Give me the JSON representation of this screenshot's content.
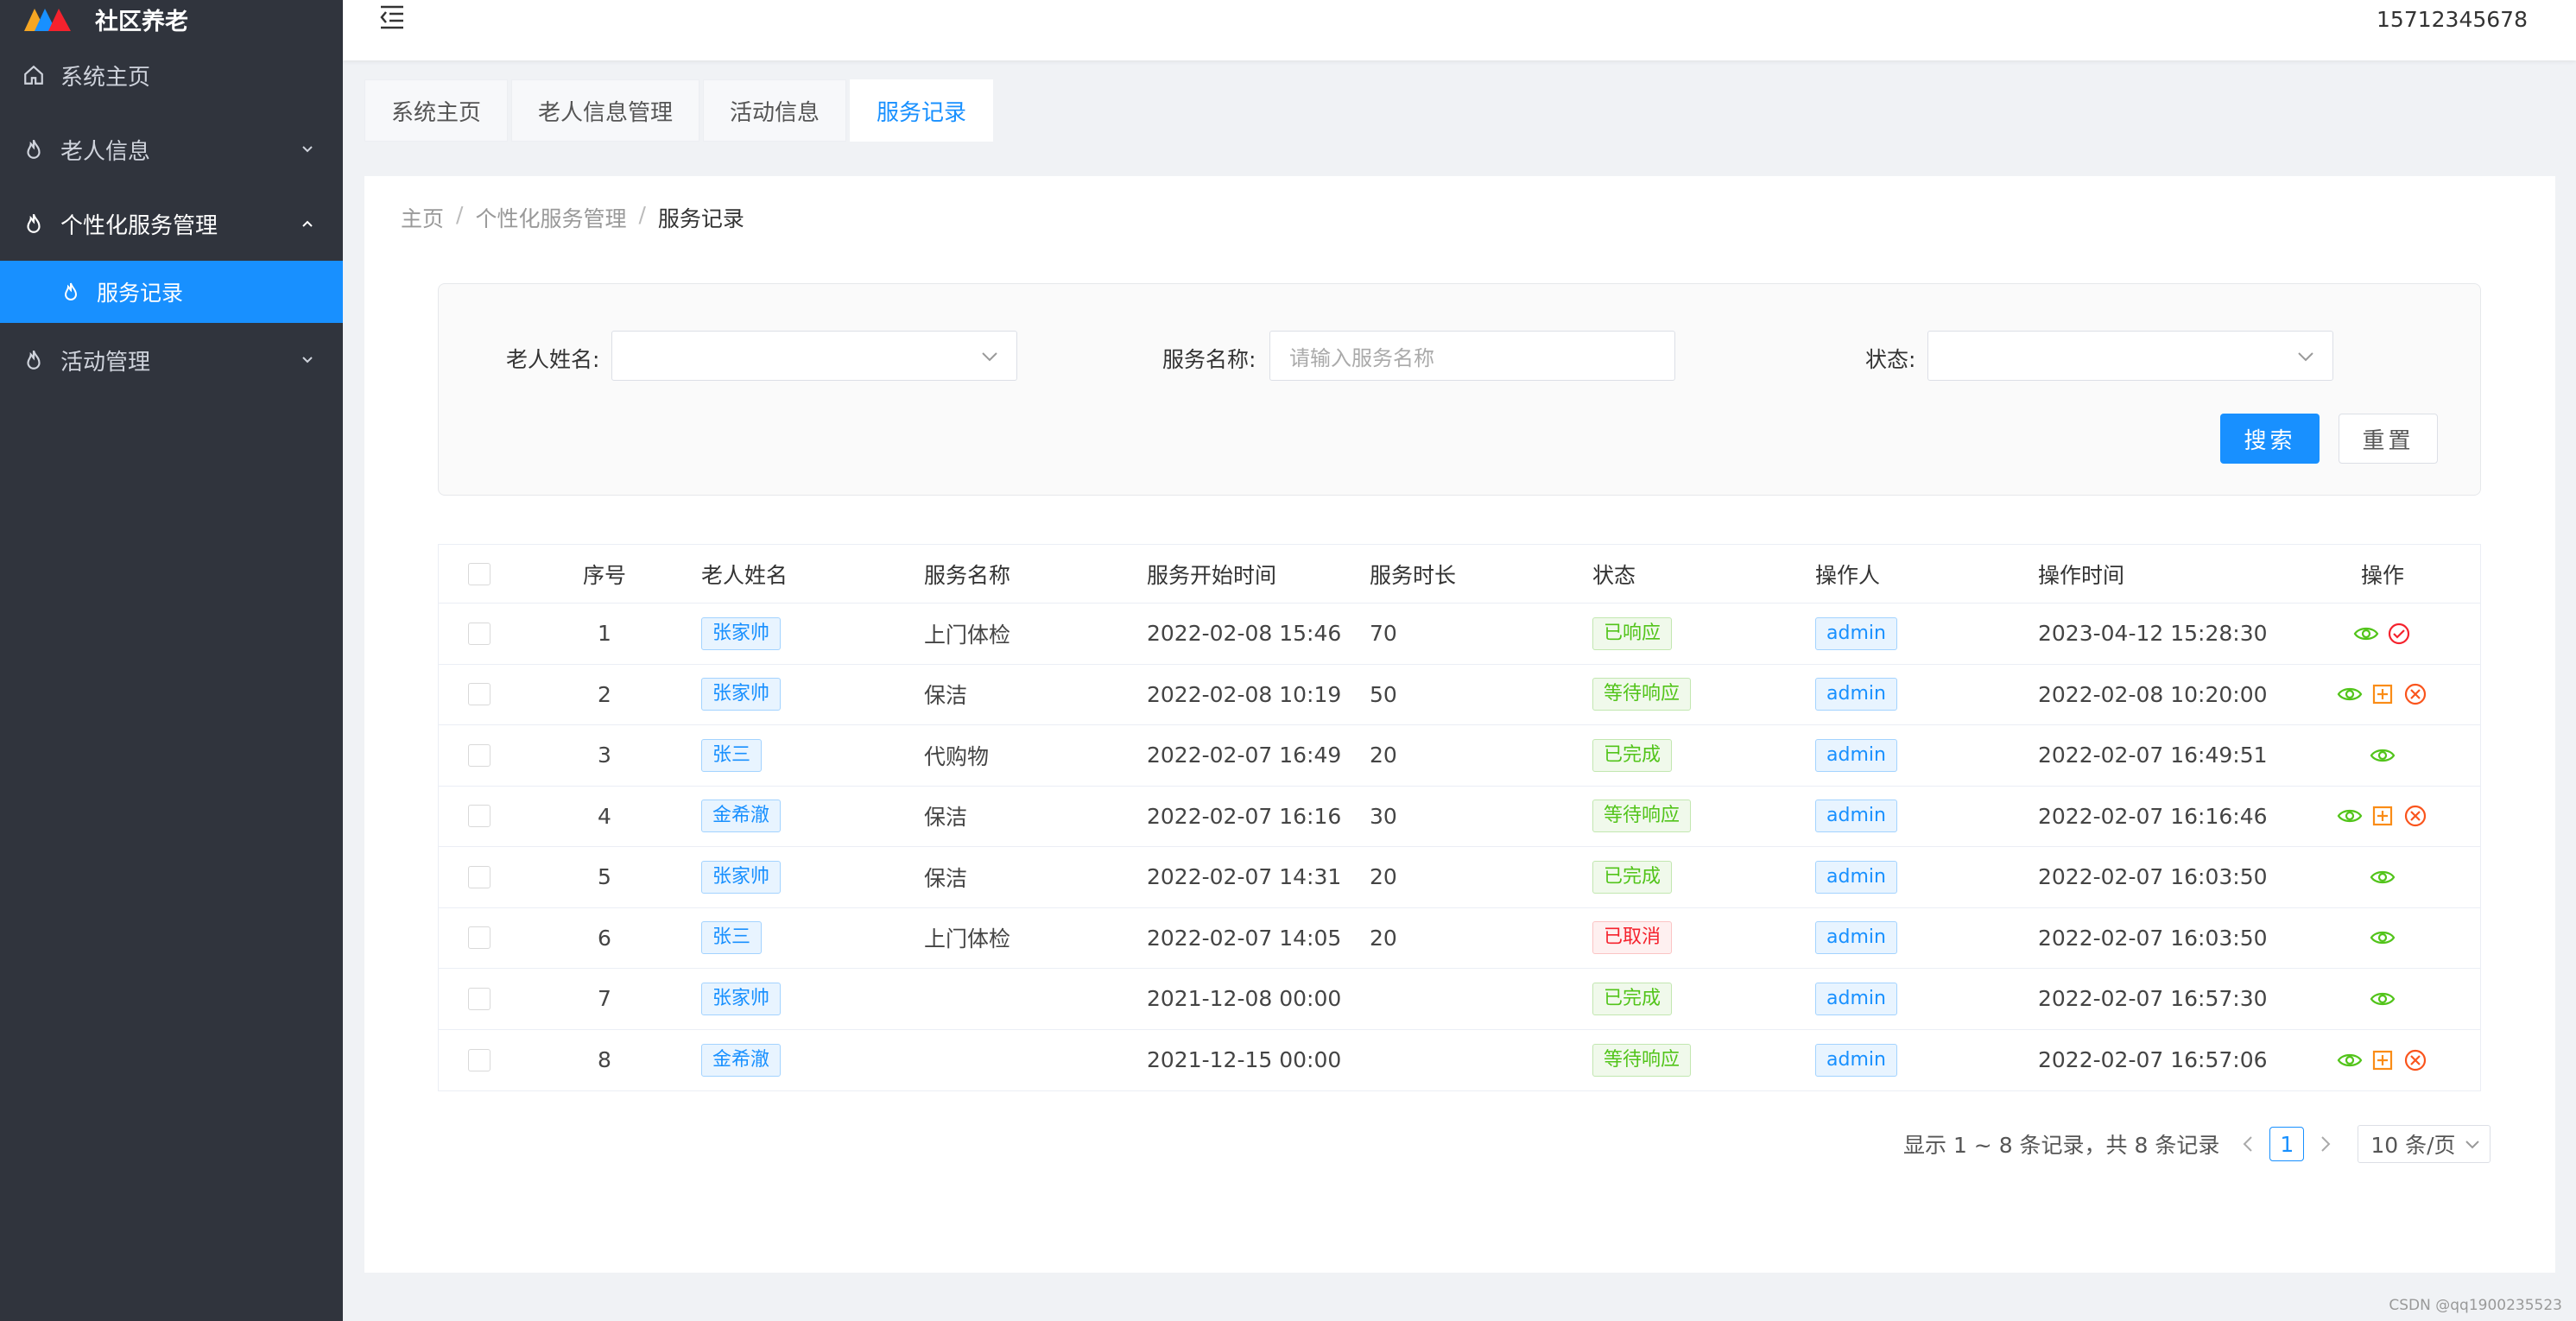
{
  "app": {
    "title": "社区养老",
    "user_phone": "15712345678"
  },
  "colors": {
    "sidebar_bg": "#30343d",
    "accent": "#1890ff",
    "success": "#52c41a",
    "danger": "#f5222d",
    "warning": "#fa8c16"
  },
  "sidebar": {
    "items": [
      {
        "label": "系统主页",
        "icon": "home-icon"
      },
      {
        "label": "老人信息",
        "icon": "flame-icon"
      },
      {
        "label": "个性化服务管理",
        "icon": "flame-icon"
      },
      {
        "label": "活动管理",
        "icon": "flame-icon"
      }
    ],
    "submenu": {
      "label": "服务记录",
      "icon": "flame-icon"
    }
  },
  "tabs": [
    {
      "label": "系统主页"
    },
    {
      "label": "老人信息管理"
    },
    {
      "label": "活动信息"
    },
    {
      "label": "服务记录"
    }
  ],
  "breadcrumb": {
    "home": "主页",
    "sep": "/",
    "level1": "个性化服务管理",
    "current": "服务记录"
  },
  "search": {
    "elder_label": "老人姓名:",
    "service_label": "服务名称:",
    "service_placeholder": "请输入服务名称",
    "status_label": "状态:",
    "search_button": "搜索",
    "reset_button": "重置"
  },
  "table": {
    "headers": [
      "序号",
      "老人姓名",
      "服务名称",
      "服务开始时间",
      "服务时长",
      "状态",
      "操作人",
      "操作时间",
      "操作"
    ],
    "rows": [
      {
        "idx": "1",
        "name": "张家帅",
        "service": "上门体检",
        "start": "2022-02-08 15:46",
        "duration": "70",
        "status": "已响应",
        "operator": "admin",
        "time": "2023-04-12 15:28:30"
      },
      {
        "idx": "2",
        "name": "张家帅",
        "service": "保洁",
        "start": "2022-02-08 10:19",
        "duration": "50",
        "status": "等待响应",
        "operator": "admin",
        "time": "2022-02-08 10:20:00"
      },
      {
        "idx": "3",
        "name": "张三",
        "service": "代购物",
        "start": "2022-02-07 16:49",
        "duration": "20",
        "status": "已完成",
        "operator": "admin",
        "time": "2022-02-07 16:49:51"
      },
      {
        "idx": "4",
        "name": "金希澈",
        "service": "保洁",
        "start": "2022-02-07 16:16",
        "duration": "30",
        "status": "等待响应",
        "operator": "admin",
        "time": "2022-02-07 16:16:46"
      },
      {
        "idx": "5",
        "name": "张家帅",
        "service": "保洁",
        "start": "2022-02-07 14:31",
        "duration": "20",
        "status": "已完成",
        "operator": "admin",
        "time": "2022-02-07 16:03:50"
      },
      {
        "idx": "6",
        "name": "张三",
        "service": "上门体检",
        "start": "2022-02-07 14:05",
        "duration": "20",
        "status": "已取消",
        "operator": "admin",
        "time": "2022-02-07 16:03:50"
      },
      {
        "idx": "7",
        "name": "张家帅",
        "service": "",
        "start": "2021-12-08 00:00",
        "duration": "",
        "status": "已完成",
        "operator": "admin",
        "time": "2022-02-07 16:57:30"
      },
      {
        "idx": "8",
        "name": "金希澈",
        "service": "",
        "start": "2021-12-15 00:00",
        "duration": "",
        "status": "等待响应",
        "operator": "admin",
        "time": "2022-02-07 16:57:06"
      }
    ]
  },
  "pagination": {
    "summary": "显示 1 ~ 8 条记录，共 8 条记录",
    "current_page": "1",
    "page_size": "10 条/页"
  },
  "watermark": "CSDN @qq1900235523"
}
